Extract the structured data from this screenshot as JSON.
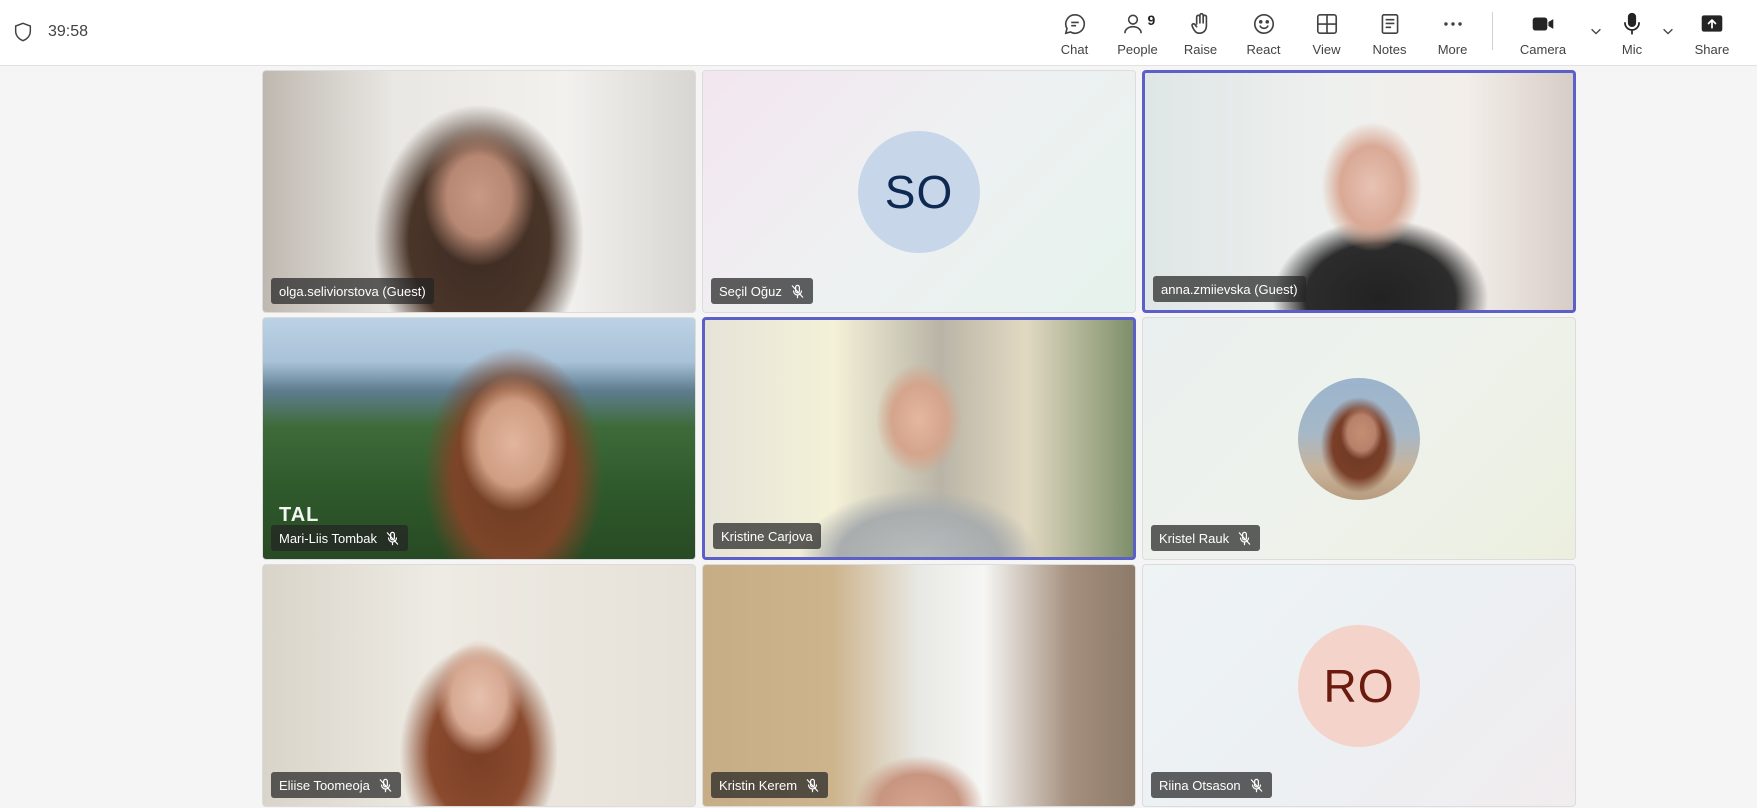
{
  "header": {
    "timer": "39:58",
    "controls": {
      "chat": "Chat",
      "people": "People",
      "people_count": "9",
      "raise": "Raise",
      "react": "React",
      "view": "View",
      "notes": "Notes",
      "more": "More",
      "camera": "Camera",
      "mic": "Mic",
      "share": "Share"
    }
  },
  "participants": [
    {
      "name": "olga.seliviorstova (Guest)",
      "muted": false,
      "active_speaker": false
    },
    {
      "name": "Seçil Oğuz",
      "muted": true,
      "active_speaker": false,
      "initials": "SO",
      "avatar_bg": "#c8d6ea",
      "avatar_fg": "#0f2a52"
    },
    {
      "name": "anna.zmiievska (Guest)",
      "muted": false,
      "active_speaker": true
    },
    {
      "name": "Mari-Liis Tombak",
      "muted": true,
      "active_speaker": false,
      "watermark": "TAL"
    },
    {
      "name": "Kristine Carjova",
      "muted": false,
      "active_speaker": true
    },
    {
      "name": "Kristel Rauk",
      "muted": true,
      "active_speaker": false
    },
    {
      "name": "Eliise Toomeoja",
      "muted": true,
      "active_speaker": false
    },
    {
      "name": "Kristin Kerem",
      "muted": true,
      "active_speaker": false
    },
    {
      "name": "Riina Otsason",
      "muted": true,
      "active_speaker": false,
      "initials": "RO",
      "avatar_bg": "#f3d3ca",
      "avatar_fg": "#6b1a0e"
    }
  ],
  "colors": {
    "active_border": "#5b5fc7",
    "nametag_bg": "#242424"
  }
}
